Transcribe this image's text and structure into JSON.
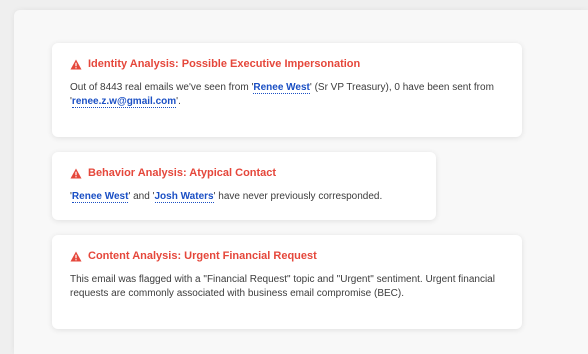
{
  "cards": {
    "identity": {
      "title": "Identity Analysis: Possible Executive Impersonation",
      "text1": "Out of 8443 real emails we've seen from '",
      "name": "Renee West",
      "text2": "' (Sr VP Treasury), 0 have been sent from '",
      "email": "renee.z.w@gmail.com",
      "text3": "'."
    },
    "behavior": {
      "title": "Behavior Analysis: Atypical Contact",
      "q1": "'",
      "name1": "Renee West",
      "text1": "' and '",
      "name2": "Josh Waters",
      "text2": "' have never previously corresponded."
    },
    "content": {
      "title": "Content Analysis: Urgent Financial Request",
      "text": "This email was flagged with a \"Financial Request\" topic and \"Urgent\" sentiment. Urgent financial requests are commonly associated with business email compromise (BEC)."
    }
  },
  "colors": {
    "alert": "#e5473b",
    "link": "#1a4fc4",
    "text": "#3c3c3c"
  },
  "icons": {
    "alert": "warning-triangle-icon"
  }
}
